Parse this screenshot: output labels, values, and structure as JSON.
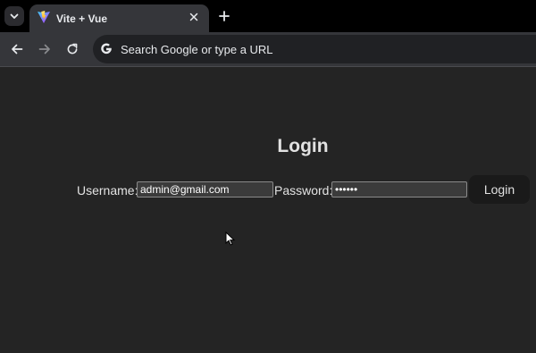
{
  "browser": {
    "tab_title": "Vite + Vue",
    "omnibox_placeholder": "Search Google or type a URL",
    "icons": {
      "tab_search": "chevron-down-icon",
      "favicon": "vite-logo-icon",
      "close": "close-icon",
      "new_tab": "plus-icon",
      "back": "back-arrow-icon",
      "forward": "forward-arrow-icon",
      "reload": "reload-icon",
      "search_engine": "google-g-icon"
    }
  },
  "page": {
    "title": "Login",
    "username_label": "Username:",
    "username_value": "admin@gmail.com",
    "password_label": "Password:",
    "password_value": "123456",
    "login_button": "Login"
  },
  "colors": {
    "page_background": "#242424",
    "text": "#dedede",
    "button_background": "#1a1a1a",
    "tab_strip": "#000000",
    "toolbar": "#35363a"
  }
}
